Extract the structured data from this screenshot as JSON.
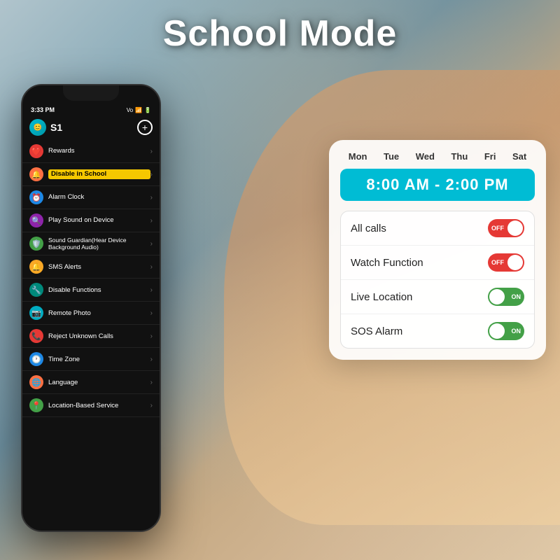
{
  "page": {
    "title": "School Mode",
    "bg_colors": [
      "#b0c4cc",
      "#8aabb8",
      "#6a8fa0"
    ]
  },
  "phone": {
    "status_bar": {
      "time": "3:33 PM",
      "signal": "Vo",
      "wifi": "WiFi",
      "battery": "77"
    },
    "user": "S1",
    "menu_items": [
      {
        "label": "Rewards",
        "icon": "❤️",
        "color": "ic-red"
      },
      {
        "label": "Disable in School",
        "icon": "🔔",
        "color": "ic-orange",
        "highlight": true
      },
      {
        "label": "Alarm Clock",
        "icon": "⏰",
        "color": "ic-blue"
      },
      {
        "label": "Play Sound on Device",
        "icon": "🔍",
        "color": "ic-purple"
      },
      {
        "label": "Sound Guardian(Hear Device Background Audio)",
        "icon": "🛡️",
        "color": "ic-green"
      },
      {
        "label": "SMS Alerts",
        "icon": "🔔",
        "color": "ic-yellow"
      },
      {
        "label": "Disable Functions",
        "icon": "🔧",
        "color": "ic-teal"
      },
      {
        "label": "Remote Photo",
        "icon": "📷",
        "color": "ic-cyan"
      },
      {
        "label": "Reject Unknown Calls",
        "icon": "📞",
        "color": "ic-red"
      },
      {
        "label": "Time Zone",
        "icon": "🕐",
        "color": "ic-blue"
      },
      {
        "label": "Language",
        "icon": "🌐",
        "color": "ic-orange"
      },
      {
        "label": "Location-Based Service",
        "icon": "📍",
        "color": "ic-green"
      }
    ]
  },
  "school_panel": {
    "days": [
      "Mon",
      "Tue",
      "Wed",
      "Thu",
      "Fri",
      "Sat"
    ],
    "time_range": "8:00 AM - 2:00 PM",
    "features": [
      {
        "label": "All calls",
        "state": "OFF"
      },
      {
        "label": "Watch Function",
        "state": "OFF"
      },
      {
        "label": "Live Location",
        "state": "ON"
      },
      {
        "label": "SOS Alarm",
        "state": "ON"
      }
    ]
  }
}
